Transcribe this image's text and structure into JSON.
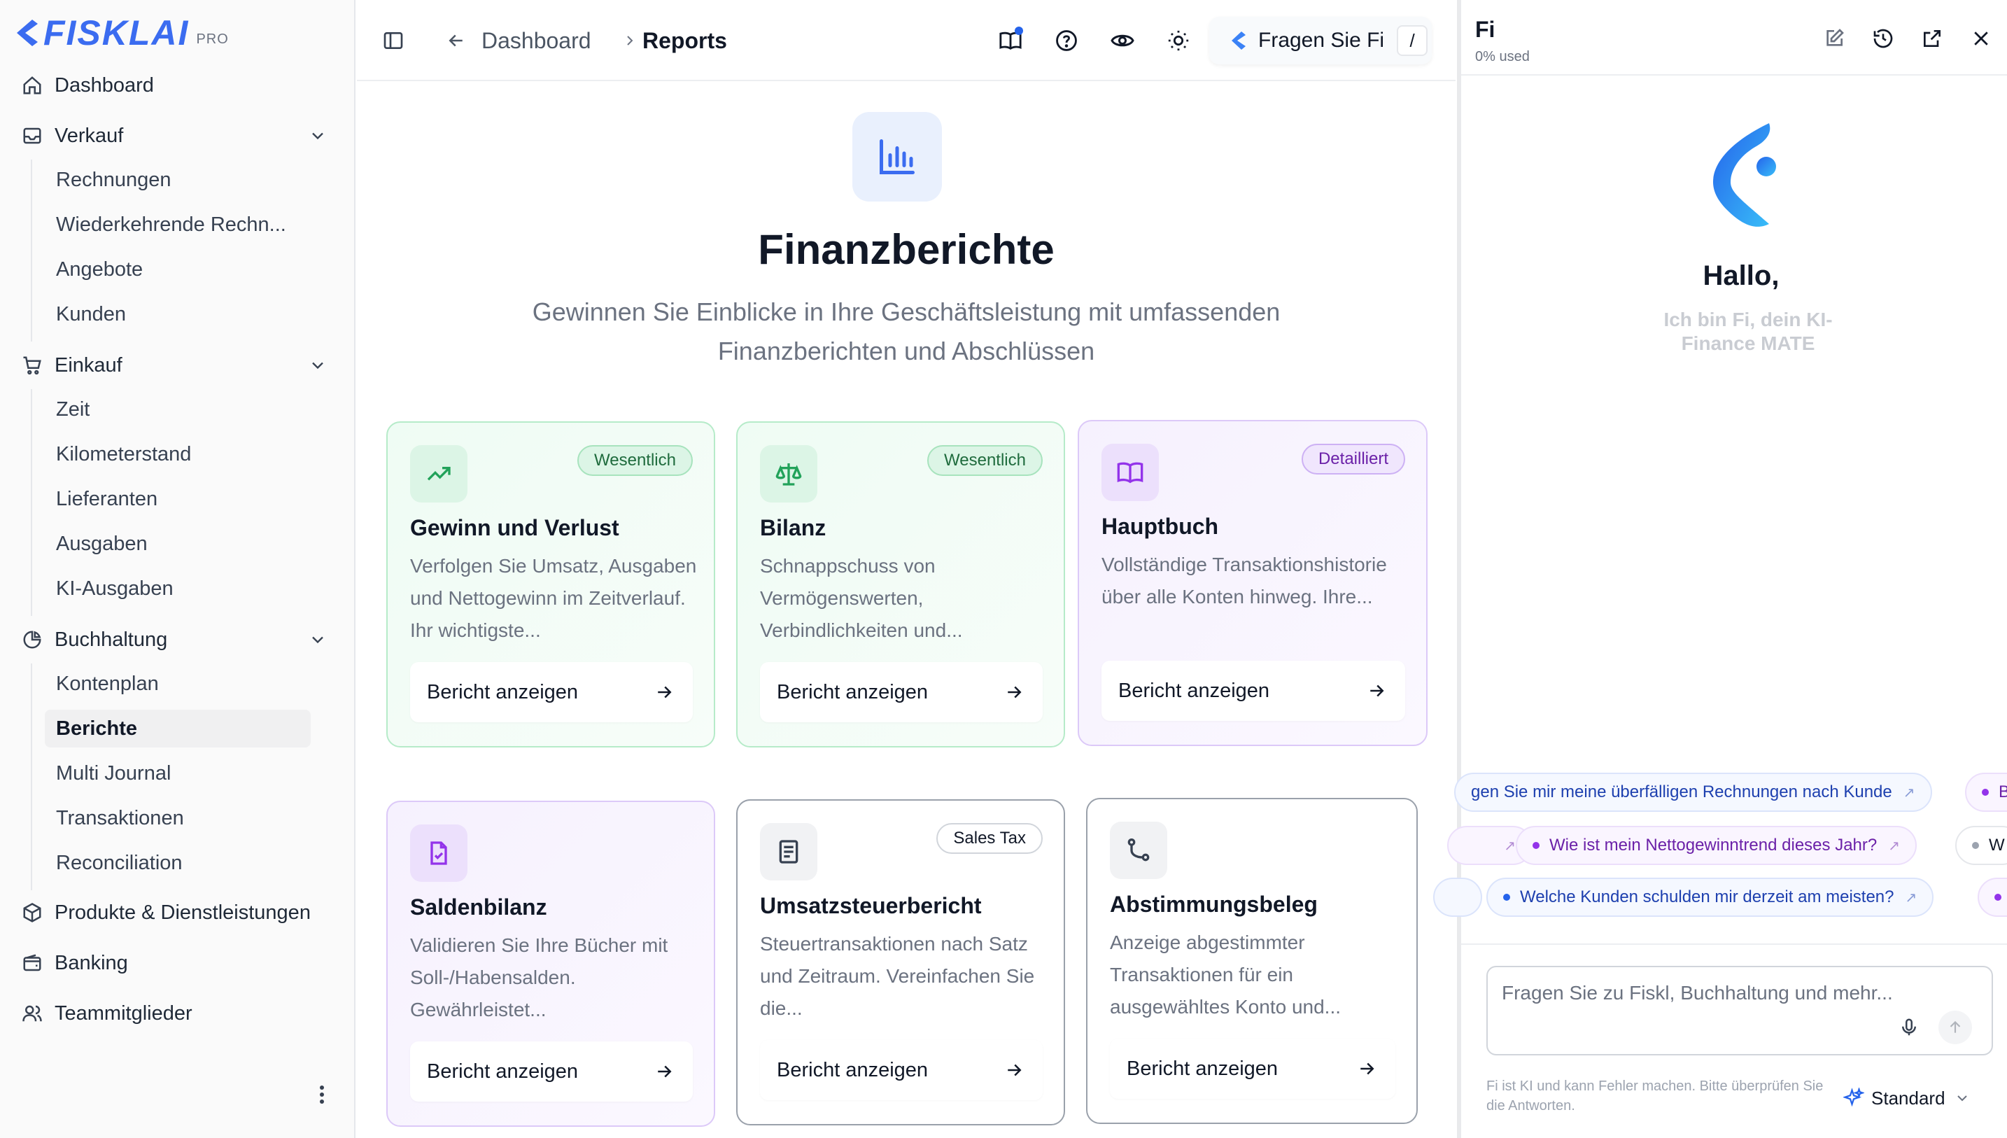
{
  "brand": {
    "name": "FISKLAI",
    "tier": "PRO"
  },
  "sidebar": {
    "items": [
      {
        "label": "Dashboard",
        "icon": "home-icon"
      },
      {
        "label": "Verkauf",
        "icon": "inbox-icon",
        "children": [
          "Rechnungen",
          "Wiederkehrende Rechn...",
          "Angebote",
          "Kunden"
        ]
      },
      {
        "label": "Einkauf",
        "icon": "cart-icon",
        "children": [
          "Zeit",
          "Kilometerstand",
          "Lieferanten",
          "Ausgaben",
          "KI-Ausgaben"
        ]
      },
      {
        "label": "Buchhaltung",
        "icon": "pie-chart-icon",
        "children": [
          "Kontenplan",
          "Berichte",
          "Multi Journal",
          "Transaktionen",
          "Reconciliation"
        ]
      },
      {
        "label": "Produkte & Dienstleistungen",
        "icon": "package-icon"
      },
      {
        "label": "Banking",
        "icon": "wallet-icon"
      },
      {
        "label": "Teammitglieder",
        "icon": "users-icon"
      }
    ],
    "active": "Berichte"
  },
  "topbar": {
    "breadcrumb_home": "Dashboard",
    "breadcrumb_current": "Reports",
    "ask_label": "Fragen Sie Fi",
    "ask_shortcut": "/"
  },
  "hero": {
    "title": "Finanzberichte",
    "subtitle": "Gewinnen Sie Einblicke in Ihre Geschäftsleistung mit umfassenden Finanzberichten und Abschlüssen"
  },
  "cards": [
    {
      "title": "Gewinn und Verlust",
      "badge": "Wesentlich",
      "desc": "Verfolgen Sie Umsatz, Ausgaben und Nettogewinn im Zeitverlauf. Ihr wichtigste...",
      "button": "Bericht anzeigen"
    },
    {
      "title": "Bilanz",
      "badge": "Wesentlich",
      "desc": "Schnappschuss von Vermögenswerten, Verbindlichkeiten und...",
      "button": "Bericht anzeigen"
    },
    {
      "title": "Hauptbuch",
      "badge": "Detailliert",
      "desc": "Vollständige Transaktionshistorie über alle Konten hinweg. Ihre...",
      "button": "Bericht anzeigen"
    },
    {
      "title": "Saldenbilanz",
      "badge": "",
      "desc": "Validieren Sie Ihre Bücher mit Soll-/Habensalden. Gewährleistet...",
      "button": "Bericht anzeigen"
    },
    {
      "title": "Umsatzsteuerbericht",
      "badge": "Sales Tax",
      "desc": "Steuertransaktionen nach Satz und Zeitraum. Vereinfachen Sie die...",
      "button": "Bericht anzeigen"
    },
    {
      "title": "Abstimmungsbeleg",
      "badge": "",
      "desc": "Anzeige abgestimmter Transaktionen für ein ausgewähltes Konto und...",
      "button": "Bericht anzeigen"
    }
  ],
  "chat": {
    "title": "Fi",
    "usage": "0% used",
    "greeting": "Hallo,",
    "intro": "Ich bin Fi, dein KI-Finance MATE",
    "suggestions": [
      "gen Sie mir meine überfälligen Rechnungen nach Kunde",
      "B",
      "Wie ist mein Nettogewinntrend dieses Jahr?",
      "W",
      "Welche Kunden schulden mir derzeit am meisten?"
    ],
    "placeholder": "Fragen Sie zu Fiskl, Buchhaltung und mehr...",
    "disclaimer": "Fi ist KI und kann Fehler machen. Bitte überprüfen Sie die Antworten.",
    "mode": "Standard"
  },
  "colors": {
    "accent": "#2563eb",
    "green": "#1f6b3d",
    "purple": "#6b21a8"
  }
}
